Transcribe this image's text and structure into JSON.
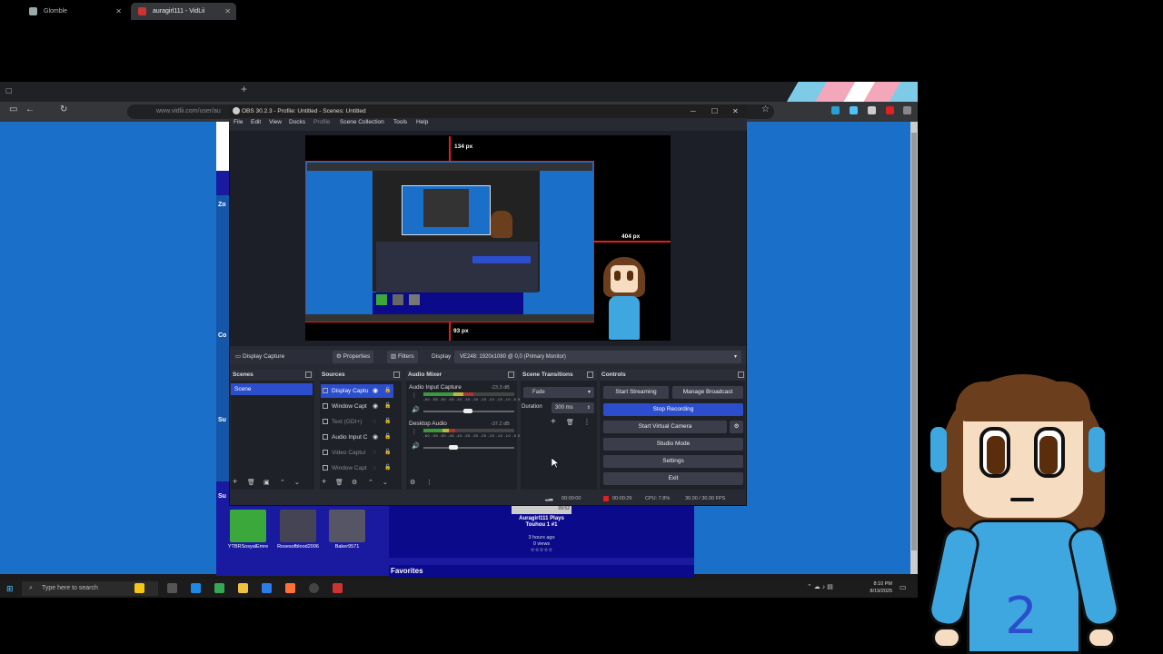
{
  "browser": {
    "tabs": [
      {
        "label": "Glomble"
      },
      {
        "label": "auragirl111 - VidLii"
      }
    ],
    "url": "www.vidlii.com/user/au",
    "page": {
      "side_labels": [
        "Zo",
        "Co",
        "Su",
        "Su"
      ],
      "subscribers": [
        {
          "name": "YTBRSosyalEmre",
          "color": "#3aa83a"
        },
        {
          "name": "Rosesofblood2006",
          "color": "#556"
        },
        {
          "name": "Baker9571",
          "color": "#667"
        }
      ],
      "video_card": {
        "duration": "09:52",
        "title": "Auragirl111 Plays Touhou 1 #1",
        "meta": "3 hours ago",
        "views": "0 views"
      },
      "favorites_label": "Favorites"
    }
  },
  "taskbar": {
    "search_placeholder": "Type here to search",
    "time": "8:10 PM",
    "date": "8/19/2025"
  },
  "obs": {
    "title": "OBS 30.2.3 - Profile: Untitled - Scenes: Untitled",
    "menu": [
      "File",
      "Edit",
      "View",
      "Docks",
      "Profile",
      "Scene Collection",
      "Tools",
      "Help"
    ],
    "preview": {
      "top_px": "134 px",
      "right_px": "404 px",
      "bottom_px": "93 px"
    },
    "source_toolbar": {
      "selected_source": "Display Capture",
      "properties": "Properties",
      "filters": "Filters",
      "display_label": "Display",
      "display_value": "VE248: 1920x1080 @ 0,0 (Primary Monitor)"
    },
    "docks": {
      "scenes": {
        "title": "Scenes",
        "items": [
          "Scene"
        ]
      },
      "sources": {
        "title": "Sources",
        "items": [
          {
            "label": "Display Captu",
            "visible": true
          },
          {
            "label": "Window Capt",
            "visible": true
          },
          {
            "label": "Text (GDI+)",
            "visible": false
          },
          {
            "label": "Audio Input C",
            "visible": true
          },
          {
            "label": "Video Captur",
            "visible": false
          },
          {
            "label": "Window Capt",
            "visible": false
          }
        ]
      },
      "mixer": {
        "title": "Audio Mixer",
        "channels": [
          {
            "name": "Audio Input Capture",
            "db": "-23.3 dB",
            "level": 0.55
          },
          {
            "name": "Desktop Audio",
            "db": "-37.2 dB",
            "level": 0.35
          }
        ],
        "ticks": "-60 -55 -50 -45 -40 -35 -30 -25 -20 -15 -10 -5 0"
      },
      "transitions": {
        "title": "Scene Transitions",
        "type": "Fade",
        "duration_label": "Duration",
        "duration": "300 ms"
      },
      "controls": {
        "title": "Controls",
        "start_streaming": "Start Streaming",
        "manage_broadcast": "Manage Broadcast",
        "stop_recording": "Stop Recording",
        "start_virtual_camera": "Start Virtual Camera",
        "studio_mode": "Studio Mode",
        "settings": "Settings",
        "exit": "Exit"
      }
    },
    "status": {
      "stream_time": "00:00:00",
      "rec_time": "00:00:29",
      "cpu": "CPU: 7.8%",
      "fps": "30.00 / 30.00 FPS"
    }
  },
  "colors": {
    "obs_bg": "#272a33",
    "accent": "#2c4ecc",
    "page_blue": "#1a6fc9",
    "rec_red": "#d22"
  }
}
